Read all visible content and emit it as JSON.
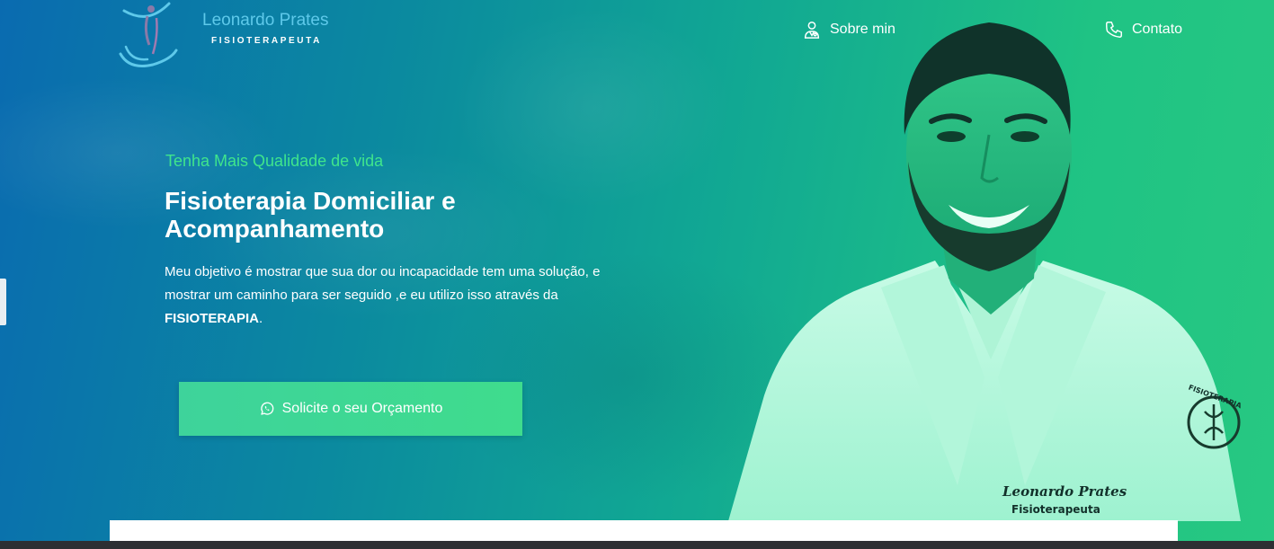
{
  "logo": {
    "name": "Leonardo Prates",
    "subtitle": "FISIOTERAPEUTA"
  },
  "nav": {
    "items": [
      {
        "label": "Sobre min",
        "icon": "doctor-icon"
      },
      {
        "label": "Contato",
        "icon": "phone-icon"
      }
    ]
  },
  "hero": {
    "tagline": "Tenha Mais Qualidade de vida",
    "headline": "Fisioterapia Domiciliar e Acompanhamento",
    "description_main": "Meu objetivo é mostrar que sua dor ou incapacidade tem uma solução, e mostrar um caminho para ser seguido ,e eu utilizo isso através da ",
    "description_bold": "FISIOTERAPIA",
    "description_end": ".",
    "cta_label": "Solicite o seu Orçamento",
    "cta_icon": "whatsapp-icon"
  },
  "portrait": {
    "coat_name": "Leonardo Prates",
    "coat_title": "Fisioterapeuta",
    "sleeve_badge": "FISIOTERAPIA"
  },
  "colors": {
    "accent_green": "#3fe58c",
    "cta_green": "#3ed39b",
    "logo_blue": "#5ec9ea"
  }
}
